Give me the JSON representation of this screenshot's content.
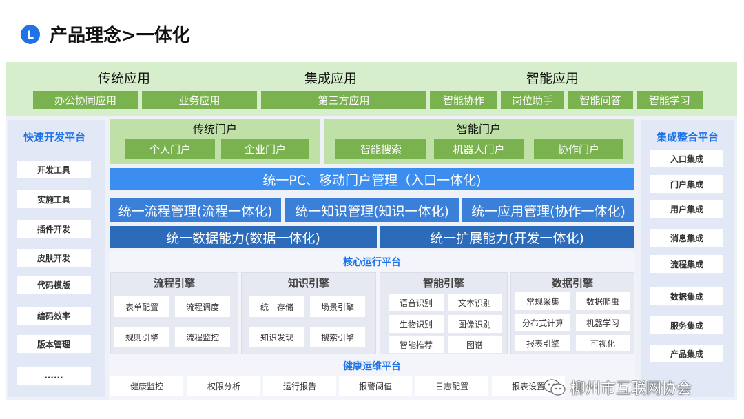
{
  "header": {
    "logo_letter": "L",
    "title": "产品理念>一体化"
  },
  "app_groups": [
    {
      "title": "传统应用",
      "items": [
        "办公协同应用",
        "业务应用"
      ]
    },
    {
      "title": "集成应用",
      "items": [
        "第三方应用"
      ]
    },
    {
      "title": "智能应用",
      "items": [
        "智能协作",
        "岗位助手",
        "智能问答",
        "智能学习"
      ]
    }
  ],
  "portals": [
    {
      "title": "传统门户",
      "items": [
        "个人门户",
        "企业门户"
      ]
    },
    {
      "title": "智能门户",
      "items": [
        "智能搜索",
        "机器人门户",
        "协作门户"
      ]
    }
  ],
  "left_panel": {
    "title": "快速开发平台",
    "items": [
      "开发工具",
      "实施工具",
      "插件开发",
      "皮肤开发",
      "代码模版",
      "编码效率",
      "版本管理",
      "......"
    ]
  },
  "right_panel": {
    "title": "集成整合平台",
    "items": [
      "入口集成",
      "门户集成",
      "用户集成",
      "消息集成",
      "流程集成",
      "数据集成",
      "服务集成",
      "产品集成"
    ]
  },
  "bars": {
    "row1": "统一PC、移动门户管理（入口一体化)",
    "row2": [
      "统一流程管理(流程一体化)",
      "统一知识管理(知识一体化)",
      "统一应用管理(协作一体化)"
    ],
    "row3": [
      "统一数据能力(数据一体化)",
      "统一扩展能力(开发一体化)"
    ]
  },
  "core": {
    "title": "核心运行平台",
    "engines": [
      {
        "title": "流程引擎",
        "items": [
          "表单配置",
          "流程调度",
          "规则引擎",
          "流程监控"
        ]
      },
      {
        "title": "知识引擎",
        "items": [
          "统一存储",
          "场景引擎",
          "知识发现",
          "搜索引擎"
        ]
      },
      {
        "title": "智能引擎",
        "items": [
          "语音识别",
          "文本识别",
          "生物识别",
          "图像识别",
          "智能推荐",
          "图谱"
        ]
      },
      {
        "title": "数据引擎",
        "items": [
          "常规采集",
          "数据爬虫",
          "分布式计算",
          "机器学习",
          "报表引擎",
          "可视化"
        ]
      }
    ]
  },
  "health": {
    "title": "健康运维平台",
    "items": [
      "健康监控",
      "权限分析",
      "运行报告",
      "报警阈值",
      "日志配置",
      "报表设置"
    ]
  },
  "watermark": {
    "text": "柳州市互联网协会"
  },
  "colors": {
    "accent_blue": "#1e73e8",
    "app_green": "#7ab24f",
    "portal_green": "#bfe0a6",
    "bar_blue": "#3b8ef0",
    "bar_dark_blue": "#2c6aba"
  }
}
